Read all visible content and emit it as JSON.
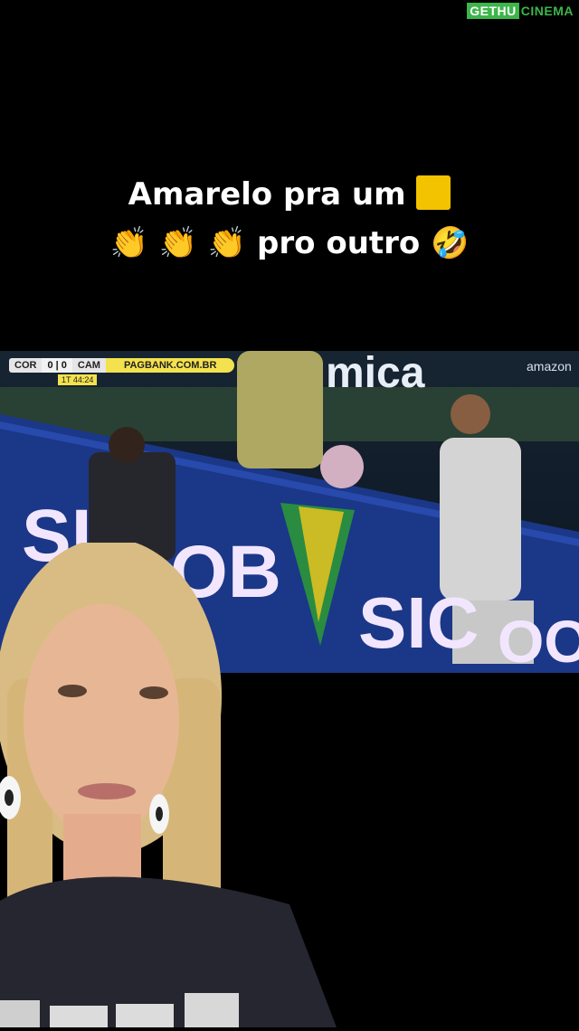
{
  "watermark": {
    "part1": "GETHU",
    "part2": "CINEMA"
  },
  "caption": {
    "line1_text": "Amarelo pra um",
    "line2_emojis": "👏 👏 👏",
    "line2_text": "pro outro",
    "laugh_emoji": "🤣"
  },
  "video": {
    "scoreboard": {
      "team_home": "COR",
      "score": "0 | 0",
      "team_away": "CAM",
      "sponsor": "PAGBANK.COM.BR",
      "clock": "1T 44:24"
    },
    "board_text_1": "SI",
    "board_text_2": "OB",
    "board_text_3": "SIC",
    "board_text_4": "OOF",
    "banner_text": "mica",
    "tv_logo": "amazon"
  },
  "colors": {
    "background": "#000000",
    "caption_text": "#ffffff",
    "accent_yellow": "#f3c300",
    "watermark_green": "#3db54a"
  }
}
